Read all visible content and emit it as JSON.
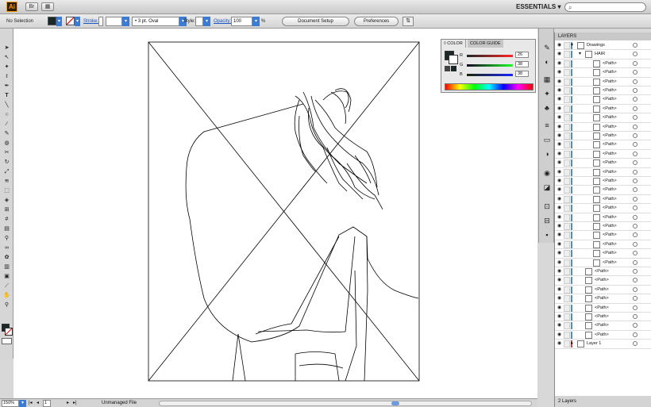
{
  "app": {
    "logo": "Ai",
    "workspace": "ESSENTIALS ▾"
  },
  "control": {
    "selection": "No Selection",
    "stroke_label": "Stroke:",
    "brush": "3 pt. Oval",
    "style_label": "Style:",
    "opacity_label": "Opacity:",
    "opacity_value": "100",
    "opacity_unit": "%",
    "doc_setup": "Document Setup",
    "preferences": "Preferences"
  },
  "color_panel": {
    "tab_color": "◊ COLOR",
    "tab_guide": "COLOR GUIDE",
    "r_label": "R",
    "r": "26",
    "g_label": "G",
    "g": "38",
    "b_label": "B",
    "b": "38"
  },
  "layers": {
    "title": "LAYERS",
    "rows": [
      {
        "name": "Drawings",
        "indent": 0,
        "color": "#4a8cd6"
      },
      {
        "name": "HAIR",
        "indent": 1,
        "color": "#4a8cd6"
      },
      {
        "name": "<Path>",
        "indent": 2,
        "color": "#4a8cd6"
      },
      {
        "name": "<Path>",
        "indent": 2,
        "color": "#4a8cd6"
      },
      {
        "name": "<Path>",
        "indent": 2,
        "color": "#4a8cd6"
      },
      {
        "name": "<Path>",
        "indent": 2,
        "color": "#4a8cd6"
      },
      {
        "name": "<Path>",
        "indent": 2,
        "color": "#4a8cd6"
      },
      {
        "name": "<Path>",
        "indent": 2,
        "color": "#4a8cd6"
      },
      {
        "name": "<Path>",
        "indent": 2,
        "color": "#4a8cd6"
      },
      {
        "name": "<Path>",
        "indent": 2,
        "color": "#4a8cd6"
      },
      {
        "name": "<Path>",
        "indent": 2,
        "color": "#4a8cd6"
      },
      {
        "name": "<Path>",
        "indent": 2,
        "color": "#4a8cd6"
      },
      {
        "name": "<Path>",
        "indent": 2,
        "color": "#4a8cd6"
      },
      {
        "name": "<Path>",
        "indent": 2,
        "color": "#4a8cd6"
      },
      {
        "name": "<Path>",
        "indent": 2,
        "color": "#4a8cd6"
      },
      {
        "name": "<Path>",
        "indent": 2,
        "color": "#4a8cd6"
      },
      {
        "name": "<Path>",
        "indent": 2,
        "color": "#4a8cd6"
      },
      {
        "name": "<Path>",
        "indent": 2,
        "color": "#4a8cd6"
      },
      {
        "name": "<Path>",
        "indent": 2,
        "color": "#4a8cd6"
      },
      {
        "name": "<Path>",
        "indent": 2,
        "color": "#4a8cd6"
      },
      {
        "name": "<Path>",
        "indent": 2,
        "color": "#4a8cd6"
      },
      {
        "name": "<Path>",
        "indent": 2,
        "color": "#4a8cd6"
      },
      {
        "name": "<Path>",
        "indent": 2,
        "color": "#4a8cd6"
      },
      {
        "name": "<Path>",
        "indent": 2,
        "color": "#4a8cd6"
      },
      {
        "name": "<Path>",
        "indent": 2,
        "color": "#4a8cd6"
      },
      {
        "name": "<Path>",
        "indent": 1,
        "color": "#4a8cd6"
      },
      {
        "name": "<Path>",
        "indent": 1,
        "color": "#4a8cd6"
      },
      {
        "name": "<Path>",
        "indent": 1,
        "color": "#4a8cd6"
      },
      {
        "name": "<Path>",
        "indent": 1,
        "color": "#4a8cd6"
      },
      {
        "name": "<Path>",
        "indent": 1,
        "color": "#4a8cd6"
      },
      {
        "name": "<Path>",
        "indent": 1,
        "color": "#4a8cd6"
      },
      {
        "name": "<Path>",
        "indent": 1,
        "color": "#4a8cd6"
      },
      {
        "name": "<Path>",
        "indent": 1,
        "color": "#4a8cd6"
      },
      {
        "name": "Layer 1",
        "indent": 0,
        "color": "#e03c3c"
      }
    ],
    "footer": "2 Layers"
  },
  "status": {
    "zoom": "150%",
    "page": "1",
    "file": "Unmanaged File"
  }
}
